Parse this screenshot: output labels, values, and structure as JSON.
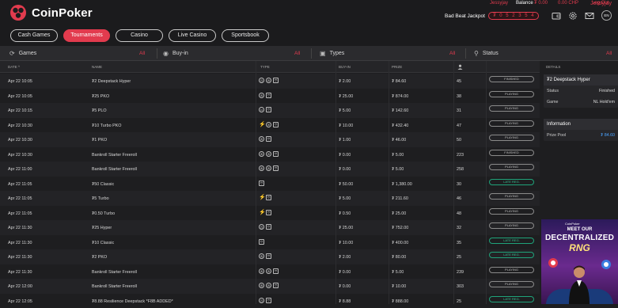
{
  "header": {
    "brand": "CoinPoker",
    "username": "Jessyjay",
    "balance_label": "Balance",
    "balance_values": [
      "₮ 0.00",
      "0.00 CHP"
    ],
    "logout_label": "Log Out",
    "jackpot_label": "Bad Beat Jackpot",
    "jackpot_digits": [
      "₮",
      "0",
      "5",
      "2",
      "3",
      "5",
      "4"
    ],
    "lang": "EN",
    "icons": [
      "wallet-icon",
      "settings-icon",
      "mail-icon"
    ]
  },
  "nav": {
    "tabs": [
      {
        "label": "Cash Games",
        "active": false
      },
      {
        "label": "Tournaments",
        "active": true
      },
      {
        "label": "Casino",
        "active": false
      },
      {
        "label": "Live Casino",
        "active": false
      },
      {
        "label": "Sportsbook",
        "active": false
      }
    ]
  },
  "filters": [
    {
      "label": "Games",
      "value": "All",
      "icon": "games-icon"
    },
    {
      "label": "Buy-in",
      "value": "All",
      "icon": "buyin-icon"
    },
    {
      "label": "Types",
      "value": "All",
      "icon": "types-icon"
    },
    {
      "label": "Status",
      "value": "All",
      "icon": "status-icon"
    }
  ],
  "table": {
    "headers": {
      "date": "DATE ^",
      "name": "NAME",
      "type": "TYPE",
      "buyin": "BUY-IN",
      "prize": "PRIZE",
      "players_icon": "players-icon"
    },
    "rows": [
      {
        "date": "Apr 22 10:05",
        "name": "₮2 Deepstack Hyper",
        "types": [
          "clock",
          "ko",
          "shield"
        ],
        "buyin": "₮ 2.00",
        "prize": "₮ 84.60",
        "players": "45",
        "status": "FINISHED",
        "late": false
      },
      {
        "date": "Apr 22 10:05",
        "name": "₮25 PKO",
        "types": [
          "ko",
          "shield"
        ],
        "buyin": "₮ 25.00",
        "prize": "₮ 874.00",
        "players": "38",
        "status": "PLAYING",
        "late": false
      },
      {
        "date": "Apr 22 10:15",
        "name": "₮5 PLO",
        "types": [
          "cards",
          "shield"
        ],
        "buyin": "₮ 5.00",
        "prize": "₮ 142.60",
        "players": "31",
        "status": "PLAYING",
        "late": false
      },
      {
        "date": "Apr 22 10:30",
        "name": "₮10 Turbo PKO",
        "types": [
          "bolt",
          "ko",
          "shield"
        ],
        "buyin": "₮ 10.00",
        "prize": "₮ 432.40",
        "players": "47",
        "status": "PLAYING",
        "late": false
      },
      {
        "date": "Apr 22 10:30",
        "name": "₮1 PKO",
        "types": [
          "ko",
          "shield"
        ],
        "buyin": "₮ 1.00",
        "prize": "₮ 46.00",
        "players": "50",
        "status": "PLAYING",
        "late": false
      },
      {
        "date": "Apr 22 10:30",
        "name": "Bankroll Starter Freeroll",
        "types": [
          "fr",
          "ko",
          "shield"
        ],
        "buyin": "₮ 0.00",
        "prize": "₮ 5.00",
        "players": "223",
        "status": "FINISHED",
        "late": false
      },
      {
        "date": "Apr 22 11:00",
        "name": "Bankroll Starter Freeroll",
        "types": [
          "fr",
          "ko",
          "shield"
        ],
        "buyin": "₮ 0.00",
        "prize": "₮ 5.00",
        "players": "258",
        "status": "PLAYING",
        "late": false
      },
      {
        "date": "Apr 22 11:05",
        "name": "₮50 Classic",
        "types": [
          "shield"
        ],
        "buyin": "₮ 50.00",
        "prize": "₮ 1,380.00",
        "players": "30",
        "status": "LATE REG.",
        "late": true
      },
      {
        "date": "Apr 22 11:05",
        "name": "₮5 Turbo",
        "types": [
          "bolt",
          "shield"
        ],
        "buyin": "₮ 5.00",
        "prize": "₮ 211.60",
        "players": "46",
        "status": "PLAYING",
        "late": false
      },
      {
        "date": "Apr 22 11:05",
        "name": "₮0.50 Turbo",
        "types": [
          "bolt",
          "shield"
        ],
        "buyin": "₮ 0.50",
        "prize": "₮ 25.00",
        "players": "48",
        "status": "PLAYING",
        "late": false
      },
      {
        "date": "Apr 22 11:30",
        "name": "₮25 Hyper",
        "types": [
          "clock",
          "shield"
        ],
        "buyin": "₮ 25.00",
        "prize": "₮ 752.00",
        "players": "32",
        "status": "PLAYING",
        "late": false
      },
      {
        "date": "Apr 22 11:30",
        "name": "₮10 Classic",
        "types": [
          "shield"
        ],
        "buyin": "₮ 10.00",
        "prize": "₮ 400.00",
        "players": "35",
        "status": "LATE REG.",
        "late": true
      },
      {
        "date": "Apr 22 11:30",
        "name": "₮2 PKO",
        "types": [
          "ko",
          "shield"
        ],
        "buyin": "₮ 2.00",
        "prize": "₮ 80.00",
        "players": "25",
        "status": "LATE REG.",
        "late": true
      },
      {
        "date": "Apr 22 11:30",
        "name": "Bankroll Starter Freeroll",
        "types": [
          "fr",
          "ko",
          "shield"
        ],
        "buyin": "₮ 0.00",
        "prize": "₮ 5.00",
        "players": "239",
        "status": "PLAYING",
        "late": false
      },
      {
        "date": "Apr 22 12:00",
        "name": "Bankroll Starter Freeroll",
        "types": [
          "fr",
          "ko",
          "shield"
        ],
        "buyin": "₮ 0.00",
        "prize": "₮ 10.00",
        "players": "303",
        "status": "PLAYING",
        "late": false
      },
      {
        "date": "Apr 22 12:05",
        "name": "₮8.88 Resilience Deepstack *F8B ADDED*",
        "types": [
          "clock",
          "shield"
        ],
        "buyin": "₮ 8.88",
        "prize": "₮ 888.00",
        "players": "25",
        "status": "LATE REG.",
        "late": true
      }
    ]
  },
  "detail": {
    "header": "DETAILS",
    "title": "₮2 Deepstack Hyper",
    "rows": [
      {
        "label": "Status",
        "value": "Finished"
      },
      {
        "label": "Game",
        "value": "NL Hold'em"
      }
    ],
    "info_title": "Information",
    "info_rows": [
      {
        "label": "Prize Pool",
        "value": "₮ 84.60"
      }
    ]
  },
  "promo": {
    "logo": "CoinPoker",
    "line1": "MEET OUR",
    "line2": "DECENTRALIZED",
    "line3": "RNG"
  },
  "colors": {
    "accent": "#e23b4e",
    "late": "#36c494",
    "bg": "#1e1e20"
  }
}
